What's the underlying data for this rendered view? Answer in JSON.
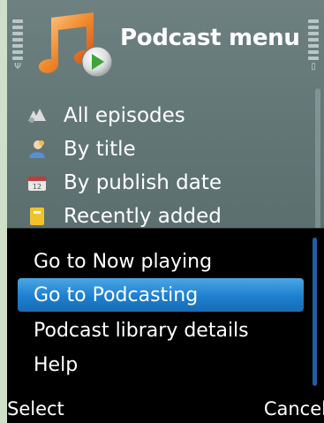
{
  "header": {
    "title": "Podcast menu",
    "app_icon": "podcast-music-note-play-icon"
  },
  "menu": {
    "items": [
      {
        "label": "All episodes",
        "icon": "episodes-icon"
      },
      {
        "label": "By title",
        "icon": "person-icon"
      },
      {
        "label": "By publish date",
        "icon": "calendar-icon"
      },
      {
        "label": "Recently added",
        "icon": "note-icon"
      }
    ]
  },
  "options": {
    "items": [
      {
        "label": "Go to Now playing"
      },
      {
        "label": "Go to Podcasting",
        "selected": true
      },
      {
        "label": "Podcast library details"
      },
      {
        "label": "Help"
      }
    ]
  },
  "softkeys": {
    "left": "Select",
    "right": "Cancel"
  },
  "colors": {
    "highlight": "#1e7fce",
    "screen_bg": "#5f7373",
    "frame": "#cfe0c8"
  }
}
